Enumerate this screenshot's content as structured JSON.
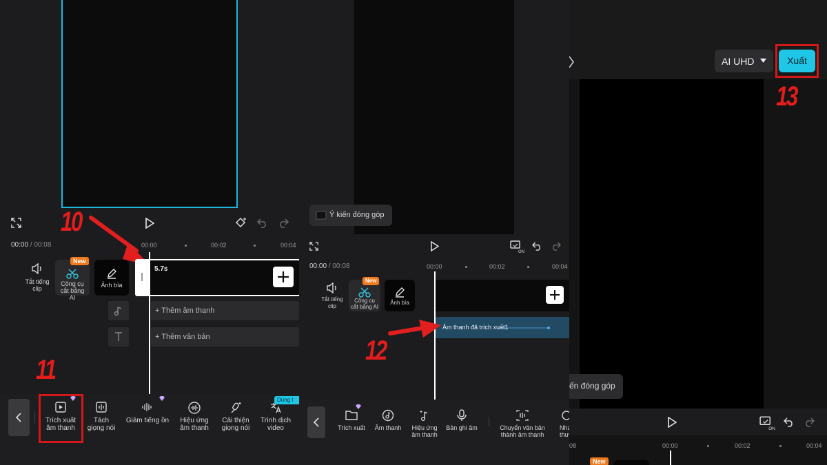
{
  "panel1": {
    "step": "10",
    "step2": "11",
    "time_current": "00:00",
    "time_total": "/ 00:08",
    "ticks": [
      "00:00",
      "00:02",
      "00:04"
    ],
    "clip_duration": "5.7s",
    "left_tools": [
      {
        "label": "Tắt tiếng clip",
        "icon": "speaker-icon"
      },
      {
        "label": "Công cụ cắt bằng AI",
        "icon": "ai-scissors-icon",
        "badge": "New"
      },
      {
        "label": "Ảnh bìa",
        "icon": "pencil-icon"
      }
    ],
    "add_audio": "Thêm âm thanh",
    "add_text": "Thêm văn bản",
    "toolbar": [
      {
        "label": "Trích xuất âm thanh",
        "icon": "extract-audio-icon",
        "premium": true
      },
      {
        "label": "Tách giọng nói",
        "icon": "split-voice-icon"
      },
      {
        "label": "Giảm tiếng ồn",
        "icon": "noise-reduce-icon",
        "premium": true
      },
      {
        "label": "Hiệu ứng âm thanh",
        "icon": "sound-effect-icon"
      },
      {
        "label": "Cải thiện giọng nói",
        "icon": "enhance-voice-icon"
      },
      {
        "label": "Trình dịch video",
        "icon": "translate-icon",
        "badge": "Dùng t"
      }
    ]
  },
  "panel2": {
    "step": "12",
    "feedback": "Ý kiến đóng góp",
    "time_current": "00:00",
    "time_total": "/ 00:08",
    "ticks": [
      "00:00",
      "00:02",
      "00:04"
    ],
    "left_tools": [
      {
        "label": "Tắt tiếng clip",
        "icon": "speaker-icon"
      },
      {
        "label": "Công cụ cắt bằng AI",
        "icon": "ai-scissors-icon",
        "badge": "New"
      },
      {
        "label": "Ảnh bìa",
        "icon": "pencil-icon"
      }
    ],
    "audio_track": "Âm thanh đã trích xuất1",
    "toolbar": [
      {
        "label": "Trích xuất",
        "icon": "folder-icon",
        "premium": true
      },
      {
        "label": "Âm thanh",
        "icon": "music-disc-icon"
      },
      {
        "label": "Hiệu ứng âm thanh",
        "icon": "music-note-sparkle-icon"
      },
      {
        "label": "Bản ghi âm",
        "icon": "mic-icon"
      },
      {
        "label": "Chuyển văn bản thành âm thanh",
        "icon": "tts-icon"
      },
      {
        "label": "Nha thươ",
        "icon": "more-icon"
      }
    ]
  },
  "panel3": {
    "step": "13",
    "quality": "AI UHD",
    "export": "Xuất",
    "feedback": "ến đóng góp",
    "ticks": [
      "08",
      "00:00",
      "00:02",
      "00:04"
    ],
    "badge": "New"
  },
  "colors": {
    "accent": "#1fc6e6",
    "red": "#d41717",
    "new_badge": "#f07a1e"
  }
}
